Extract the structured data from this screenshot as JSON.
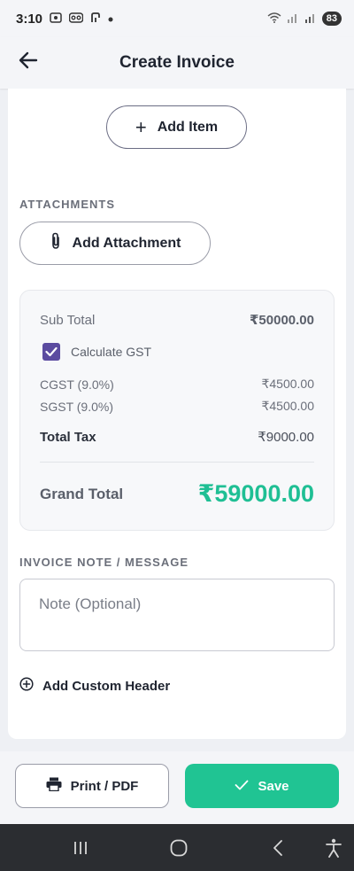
{
  "status_bar": {
    "time": "3:10",
    "battery": "83",
    "icons": [
      "screenshot-icon",
      "voicemail-icon",
      "nfc-icon",
      "dot-icon",
      "wifi-icon",
      "signal-icon",
      "signal-icon",
      "battery-icon"
    ]
  },
  "app_bar": {
    "title": "Create Invoice",
    "back_icon": "arrow-left-icon"
  },
  "items": {
    "add_item_label": "Add Item"
  },
  "attachments": {
    "section_label": "ATTACHMENTS",
    "add_attachment_label": "Add Attachment"
  },
  "summary": {
    "sub_total_label": "Sub Total",
    "sub_total_value": "₹50000.00",
    "calculate_gst_label": "Calculate GST",
    "calculate_gst_checked": true,
    "cgst_label": "CGST (9.0%)",
    "cgst_value": "₹4500.00",
    "sgst_label": "SGST (9.0%)",
    "sgst_value": "₹4500.00",
    "total_tax_label": "Total Tax",
    "total_tax_value": "₹9000.00",
    "grand_total_label": "Grand Total",
    "grand_total_value": "₹59000.00"
  },
  "note": {
    "section_label": "INVOICE NOTE / MESSAGE",
    "placeholder": "Note (Optional)",
    "value": ""
  },
  "custom_header": {
    "label": "Add Custom Header"
  },
  "actions": {
    "print_label": "Print / PDF",
    "save_label": "Save"
  },
  "colors": {
    "accent_green": "#20c493",
    "grand_total_green": "#1fbf94",
    "checkbox_purple": "#5b4ba0",
    "nav_bar": "#2b2d31"
  }
}
